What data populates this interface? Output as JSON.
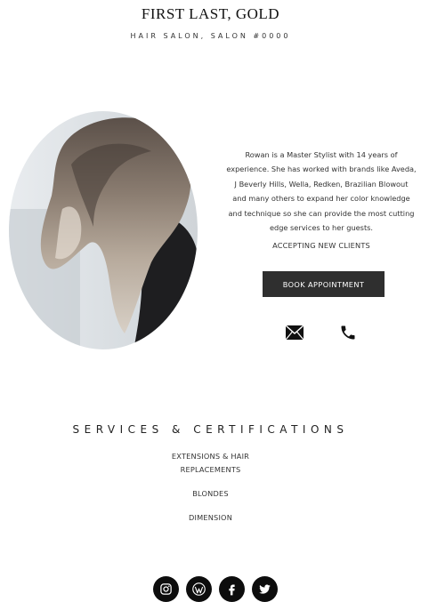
{
  "header": {
    "name": "FIRST LAST, GOLD",
    "subtitle": "HAIR SALON, SALON #0000"
  },
  "profile": {
    "photo_alt": "stylist-portrait",
    "bio": "Rowan is a Master Stylist with 14 years of experience. She has worked with brands like Aveda, J Beverly Hills, Wella, Redken, Brazilian Blowout and many others to expand her color knowledge and technique so she can provide the most cutting edge services to her guests.",
    "bio_lines": [
      "Rowan is a Master Stylist with 14 years of",
      "experience. She has worked with brands like Aveda,",
      "J Beverly Hills, Wella, Redken, Brazilian Blowout",
      "and many others to expand her color knowledge",
      "and technique so she can provide the most cutting",
      "edge services to her guests."
    ],
    "status": "ACCEPTING NEW CLIENTS",
    "book_label": "BOOK APPOINTMENT",
    "contact_icons": [
      "envelope-icon",
      "phone-icon"
    ]
  },
  "services": {
    "heading": "SERVICES & CERTIFICATIONS",
    "items": [
      {
        "line1": "EXTENSIONS & HAIR",
        "line2": "REPLACEMENTS"
      },
      {
        "line1": "BLONDES",
        "line2": ""
      },
      {
        "line1": "DIMENSION",
        "line2": ""
      }
    ]
  },
  "social": {
    "icons": [
      "instagram-icon",
      "wordpress-icon",
      "facebook-icon",
      "twitter-icon"
    ],
    "background": "#0d0d0d"
  },
  "colors": {
    "button_bg": "#2f2f2f",
    "text": "#333333"
  }
}
